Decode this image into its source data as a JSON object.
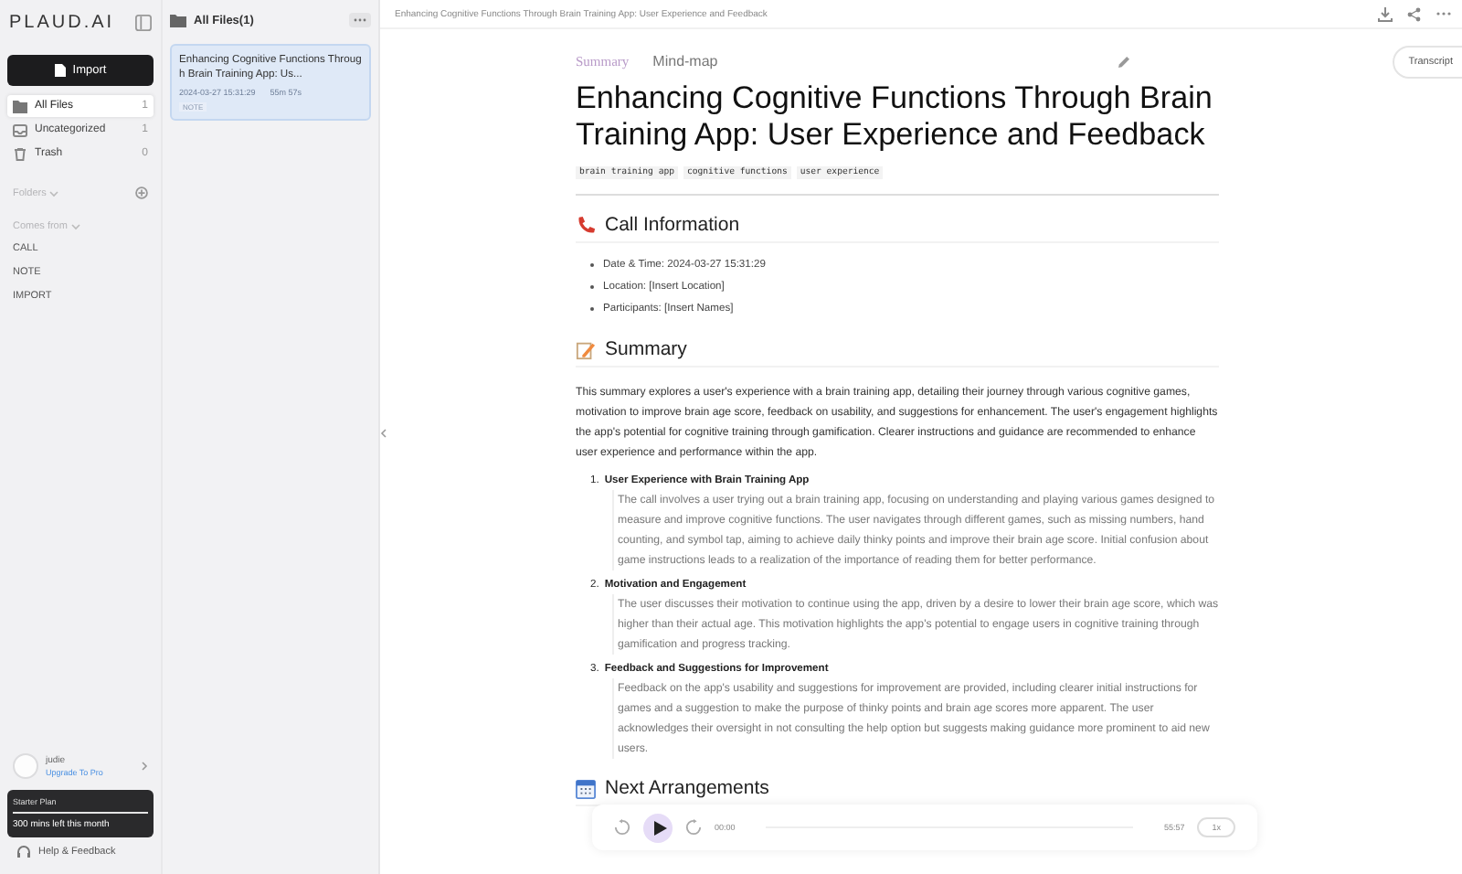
{
  "logo": "PLAUD.AI",
  "import_button": "Import",
  "nav": [
    {
      "label": "All Files",
      "count": "1",
      "selected": true,
      "kind": "folder"
    },
    {
      "label": "Uncategorized",
      "count": "1",
      "selected": false,
      "kind": "inbox"
    },
    {
      "label": "Trash",
      "count": "0",
      "selected": false,
      "kind": "trash"
    }
  ],
  "folders_label": "Folders",
  "comes_from_label": "Comes from",
  "sources": [
    "CALL",
    "NOTE",
    "IMPORT"
  ],
  "user": {
    "name": "judie",
    "upgrade": "Upgrade To Pro"
  },
  "plan": {
    "name": "Starter Plan",
    "level": 1,
    "remaining": "300 mins left this month"
  },
  "help": "Help & Feedback",
  "file_list": {
    "title": "All Files(1)",
    "files": [
      {
        "title": "Enhancing Cognitive Functions Through Brain Training App: Us...",
        "date": "2024-03-27 15:31:29",
        "duration": "55m 57s",
        "tag": "NOTE",
        "selected": true
      }
    ]
  },
  "breadcrumb": "Enhancing Cognitive Functions Through Brain Training App: User Experience and Feedback",
  "transcript_button": "Transcript",
  "tabs": [
    {
      "label": "Summary",
      "selected": true
    },
    {
      "label": "Mind-map",
      "selected": false
    }
  ],
  "document": {
    "title": "Enhancing Cognitive Functions Through Brain Training App: User Experience and Feedback",
    "tags": [
      "brain training app",
      "cognitive functions",
      "user experience"
    ],
    "sections": [
      {
        "heading": "Call Information",
        "blocks": [
          {
            "kind": "bullets",
            "items": [
              "Date & Time: 2024-03-27 15:31:29",
              "Location: [Insert Location]",
              "Participants: [Insert Names]"
            ]
          }
        ]
      },
      {
        "heading": "Summary",
        "blocks": [
          {
            "kind": "paragraph",
            "text": "This summary explores a user's experience with a brain training app, detailing their journey through various cognitive games, motivation to improve brain age score, feedback on usability, and suggestions for enhancement. The user's engagement highlights the app's potential for cognitive training through gamification. Clearer instructions and guidance are recommended to enhance user experience and performance within the app."
          },
          {
            "kind": "numbered",
            "items": [
              {
                "number": "1.",
                "title": "User Experience with Brain Training App",
                "text": "The call involves a user trying out a brain training app, focusing on understanding and playing various games designed to measure and improve cognitive functions. The user navigates through different games, such as missing numbers, hand counting, and symbol tap, aiming to achieve daily thinky points and improve their brain age score. Initial confusion about game instructions leads to a realization of the importance of reading them for better performance."
              },
              {
                "number": "2.",
                "title": "Motivation and Engagement",
                "text": "The user discusses their motivation to continue using the app, driven by a desire to lower their brain age score, which was higher than their actual age. This motivation highlights the app's potential to engage users in cognitive training through gamification and progress tracking."
              },
              {
                "number": "3.",
                "title": "Feedback and Suggestions for Improvement",
                "text": "Feedback on the app's usability and suggestions for improvement are provided, including clearer initial instructions for games and a suggestion to make the purpose of thinky points and brain age scores more apparent. The user acknowledges their oversight in not consulting the help option but suggests making guidance more prominent to aid new users."
              }
            ]
          }
        ]
      },
      {
        "heading": "Next Arrangements"
      }
    ]
  },
  "player": {
    "current": "00:00",
    "total": "55:57",
    "speed": "1x"
  }
}
